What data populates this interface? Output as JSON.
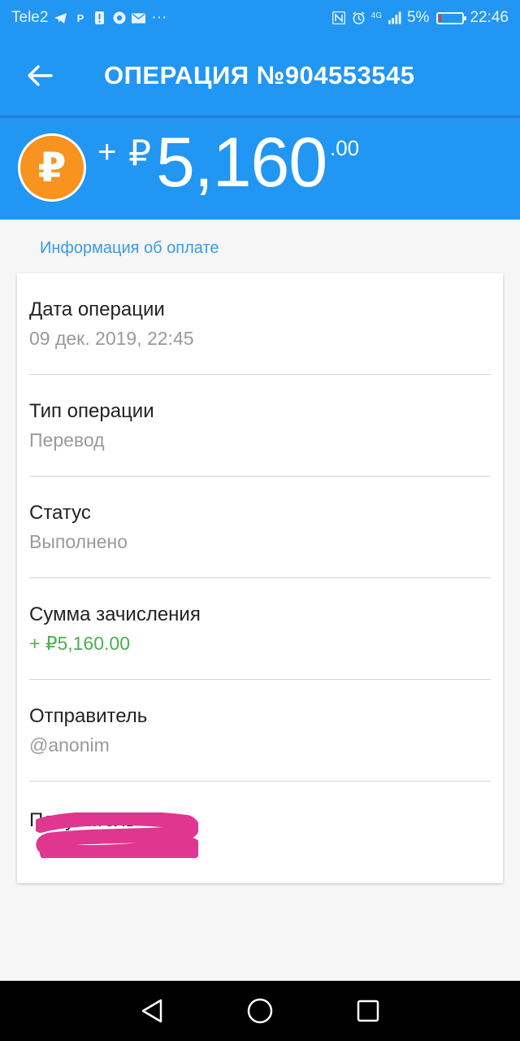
{
  "status_bar": {
    "carrier": "Tele2",
    "battery_percent": "5%",
    "battery_level": 0.05,
    "time": "22:46",
    "icons_left": [
      "telegram-icon",
      "parking-icon",
      "alert-icon",
      "chrome-icon",
      "mail-icon",
      "more-icon"
    ],
    "icons_right": [
      "nfc-icon",
      "alarm-icon",
      "signal-icon"
    ],
    "network": "4G",
    "more": "···"
  },
  "app_bar": {
    "title": "ОПЕРАЦИЯ №904553545",
    "back_icon": "arrow-left-icon"
  },
  "amount": {
    "sign": "+",
    "currency": "₽",
    "main": "5,160",
    "cents": ".00",
    "coin_glyph": "₽",
    "coin_color": "#f7931e"
  },
  "section": {
    "title": "Информация об оплате"
  },
  "rows": [
    {
      "label": "Дата операции",
      "value": "09 дек. 2019, 22:45"
    },
    {
      "label": "Тип операции",
      "value": "Перевод"
    },
    {
      "label": "Статус",
      "value": "Выполнено"
    },
    {
      "label": "Сумма зачисления",
      "value": "+ ₽5,160.00",
      "color": "#4caf50"
    },
    {
      "label": "Отправитель",
      "value": "@anonim"
    },
    {
      "label": "Получатель",
      "value": "",
      "redacted": true
    }
  ],
  "colors": {
    "primary": "#2196f3",
    "accent_green": "#4caf50",
    "redaction": "#e0368f"
  }
}
